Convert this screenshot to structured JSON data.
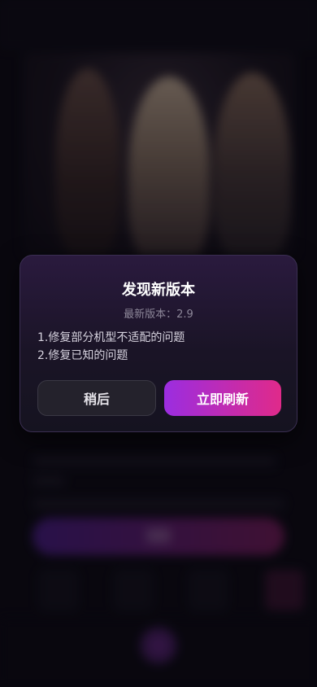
{
  "dialog": {
    "title": "发现新版本",
    "version_text": "最新版本：2.9",
    "notes": [
      "1.修复部分机型不适配的问题",
      "2.修复已知的问题"
    ],
    "later_label": "稍后",
    "refresh_label": "立即刷新"
  },
  "colors": {
    "accent_gradient_start": "#9b2de0",
    "accent_gradient_end": "#e02a8a",
    "dialog_background": "#1a1426"
  }
}
